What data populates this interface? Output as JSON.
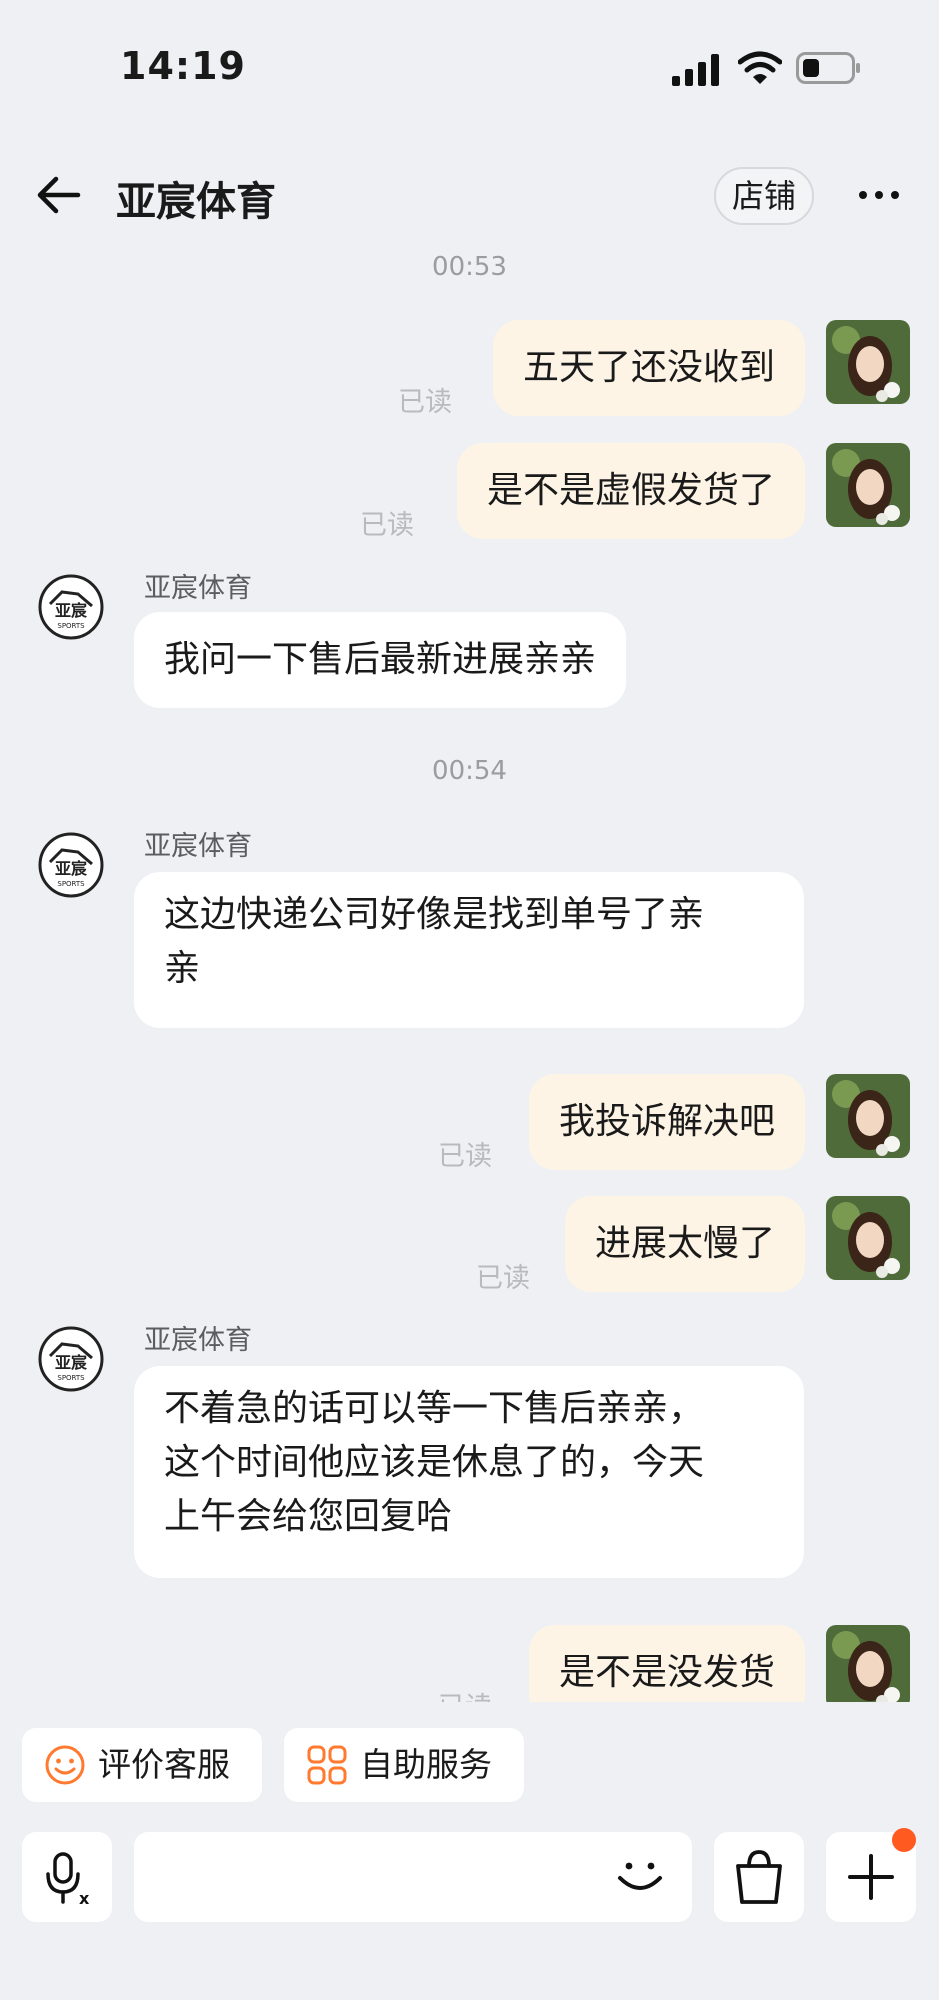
{
  "status_bar": {
    "time": "14:19"
  },
  "header": {
    "title": "亚宸体育",
    "store_button": "店铺"
  },
  "chat": {
    "shop_name": "亚宸体育",
    "read_label": "已读",
    "timestamps": [
      "00:53",
      "00:54"
    ],
    "messages": [
      {
        "from": "me",
        "text": "五天了还没收到",
        "status": "已读"
      },
      {
        "from": "me",
        "text": "是不是虚假发货了",
        "status": "已读"
      },
      {
        "from": "shop",
        "sender": "亚宸体育",
        "text": "我问一下售后最新进展亲亲"
      },
      {
        "from": "shop",
        "sender": "亚宸体育",
        "lines": [
          "这边快递公司好像是找到单号了亲",
          "亲"
        ]
      },
      {
        "from": "me",
        "text": "我投诉解决吧",
        "status": "已读"
      },
      {
        "from": "me",
        "text": "进展太慢了",
        "status": "已读"
      },
      {
        "from": "shop",
        "sender": "亚宸体育",
        "lines": [
          "不着急的话可以等一下售后亲亲，",
          "这个时间他应该是休息了的，今天",
          "上午会给您回复哈"
        ]
      },
      {
        "from": "me",
        "text": "是不是没发货",
        "status": "已读"
      }
    ]
  },
  "quick_actions": [
    {
      "label": "评价客服",
      "icon": "smile-icon"
    },
    {
      "label": "自助服务",
      "icon": "grid-icon"
    }
  ],
  "input": {
    "placeholder": ""
  },
  "colors": {
    "accent": "#ff7a2e",
    "outgoing_bubble": "#fdf4e6",
    "background": "#eef0f3"
  }
}
